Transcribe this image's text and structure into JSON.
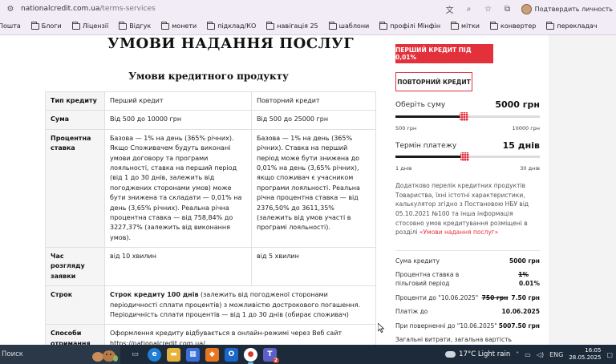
{
  "browser": {
    "url_host": "nationalcredit.com.ua",
    "url_path": "/terms-services",
    "profile_label": "Подтвердить личность"
  },
  "bookmarks": [
    {
      "label": "Пошта"
    },
    {
      "label": "Блоги"
    },
    {
      "label": "Ліцензії"
    },
    {
      "label": "Відгук"
    },
    {
      "label": "монети"
    },
    {
      "label": "підклад/КО"
    },
    {
      "label": "навігація 25"
    },
    {
      "label": "шаблони"
    },
    {
      "label": "профілі Мінфін"
    },
    {
      "label": "мітки"
    },
    {
      "label": "конвертер"
    },
    {
      "label": "перекладач"
    }
  ],
  "page": {
    "title": "УМОВИ НАДАННЯ ПОСЛУГ",
    "subtitle": "Умови кредитного продукту"
  },
  "table": {
    "rows": [
      {
        "key": "Тип кредиту",
        "c1": "Перший кредит",
        "c2": "Повторний кредит"
      },
      {
        "key": "Сума",
        "c1": "Від 500 до 10000 грн",
        "c2": "Від 500 до 25000 грн"
      },
      {
        "key": "Процентна ставка",
        "c1": "Базова — 1% на день (365% річних). Якщо Споживачем будуть виконані умови договору та програми лояльності, ставка на перший період (від 1 до 30 днів, залежить від погоджених сторонами умов) може бути знижена та складати — 0,01% на день (3,65% річних). Реальна річна процентна ставка — від 758,84% до 3227,37% (залежить від виконання умов).",
        "c2": "Базова — 1% на день (365% річних). Ставка на перший період може бути знижена до 0,01% на день (3,65% річних), якщо споживач є учасником програми лояльності. Реальна річна процентна ставка — від 2376,50% до 3611,35% (залежить від умов участі в програмі лояльності)."
      },
      {
        "key": "Час розгляду заявки",
        "c1": "від 10 хвилин",
        "c2": "від 5 хвилин"
      },
      {
        "key": "Строк",
        "full_bold": "Строк кредиту 100 днів",
        "full_rest": " (залежить від погодженої сторонами періодичності сплати процентів) з можливістю дострокового погашення. Періодичність сплати процентів — від 1 до 30 днів (обирає споживач)"
      },
      {
        "key": "Способи отримання кредиту",
        "full": "Оформлення кредиту відбувається в онлайн-режимі через Веб сайт https://nationalcredit.com.ua/"
      }
    ]
  },
  "sidebar": {
    "btn_first": "ПЕРШИЙ КРЕДИТ ПІД 0,01%",
    "btn_repeat": "ПОВТОРНИЙ КРЕДИТ",
    "amount": {
      "label": "Оберіть суму",
      "value": "5000 грн",
      "min": "500 грн",
      "max": "10000 грн",
      "fraction": 0.47
    },
    "term": {
      "label": "Термін платежу",
      "value": "15 днів",
      "min": "1 днів",
      "max": "30 днів",
      "fraction": 0.48
    },
    "disclaimer": "Додатково перелік кредитних продуктів Товариства, їхні істотні характеристики, калькулятор згідно з Постановою НБУ від 05.10.2021 №100 та інша інформація стосовно умов кредитування розміщені в розділі ",
    "disclaimer_link": "«Умови надання послуг»",
    "summary": [
      {
        "label": "Сума кредиту",
        "value": "5000 грн"
      },
      {
        "label": "Процентна ставка в пільговий період",
        "strike": "1%",
        "value": "0.01%"
      },
      {
        "label": "Проценти до \"10.06.2025\"",
        "strike": "750 грн",
        "value": "7.50 грн"
      },
      {
        "label": "Платіж до",
        "value": "10.06.2025"
      },
      {
        "label": "При поверненні до \"10.06.2025\"",
        "value": "5007.50 грн"
      },
      {
        "label": "Загальні витрати, загальна вартість кредиту,",
        "value": ""
      }
    ]
  },
  "taskbar": {
    "search": "Поиск",
    "weather": "17°C  Light rain",
    "lang": "ENG",
    "time": "16:05",
    "date": "28.05.2025",
    "badge": "2"
  },
  "colors": {
    "brand_red": "#e3313c",
    "taskbar": "#1c2a3a"
  }
}
